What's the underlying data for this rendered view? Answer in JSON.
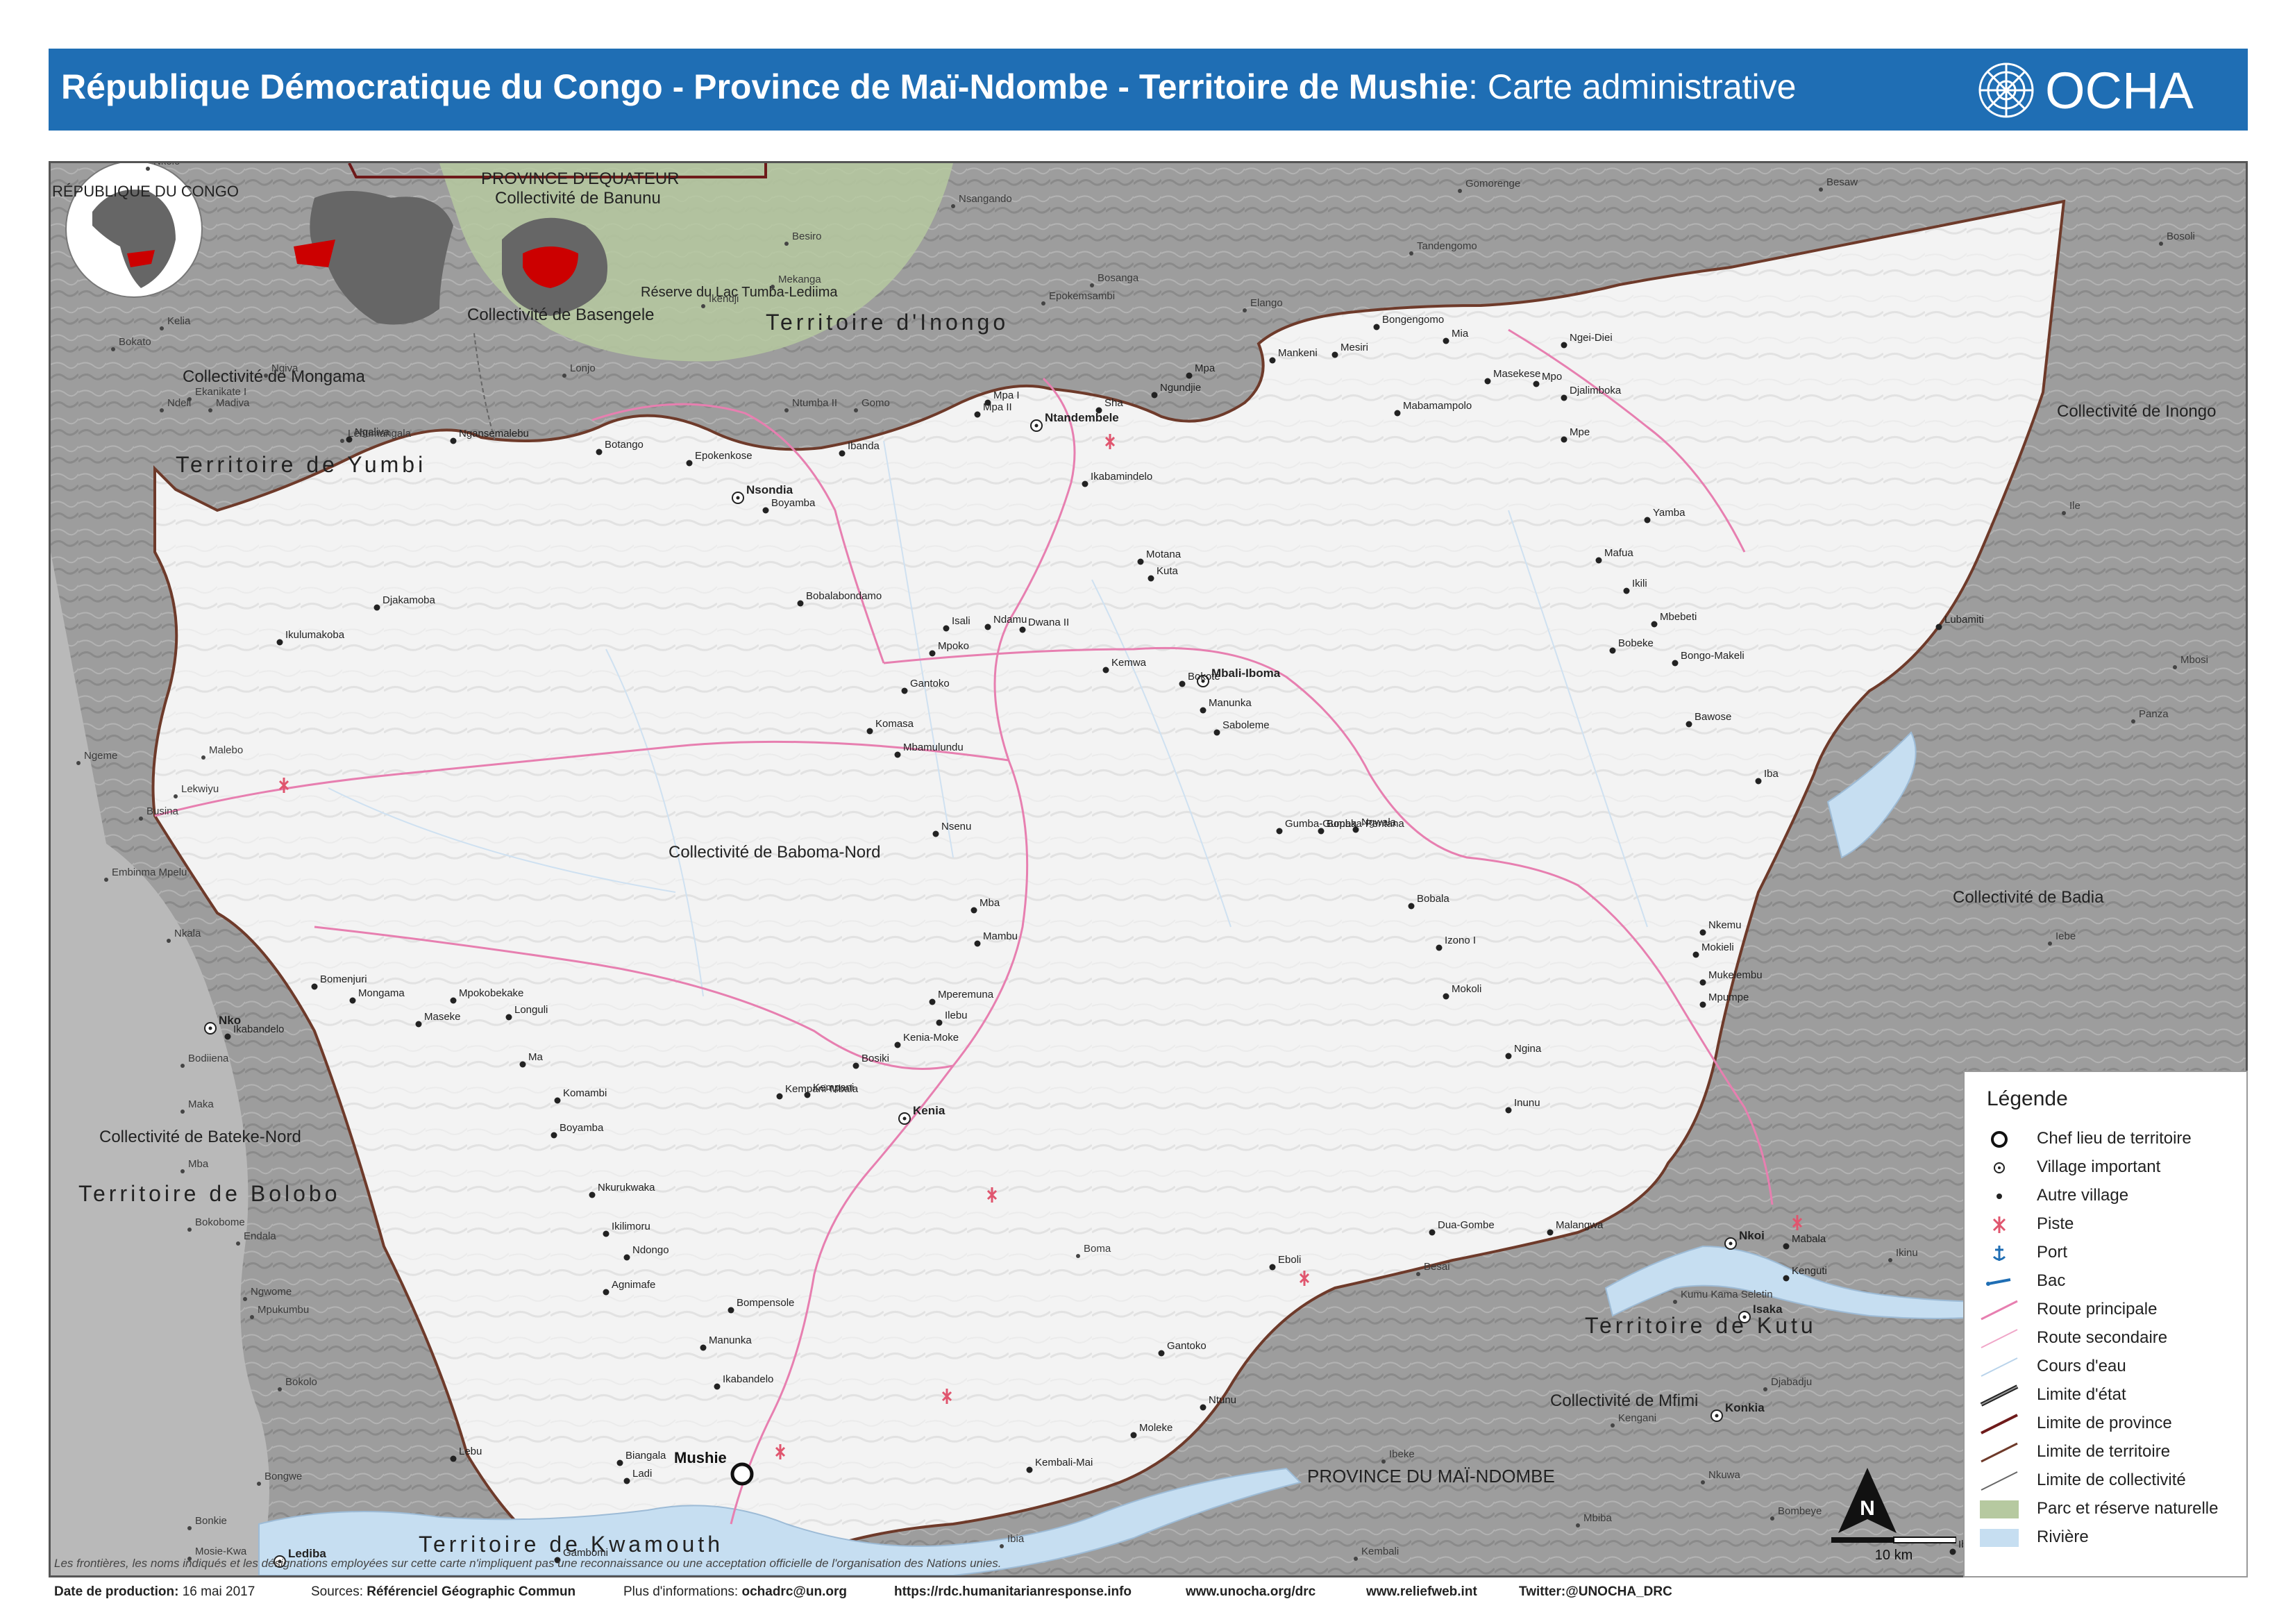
{
  "header": {
    "title_bold": "République Démocratique du Congo - Province de Maï-Ndombe - Territoire de Mushie",
    "title_rest": ": Carte administrative",
    "logo_text": "OCHA",
    "color": "#1f6eb4"
  },
  "map": {
    "region_labels": {
      "territoire_inongo": "Territoire d'Inongo",
      "territoire_yumbi": "Territoire de Yumbi",
      "territoire_bolobo": "Territoire de Bolobo",
      "territoire_kwamouth": "Territoire de Kwamouth",
      "territoire_kutu": "Territoire de Kutu",
      "province_equateur": "PROVINCE D'EQUATEUR",
      "province_maindombe": "PROVINCE DU MAÏ-NDOMBE",
      "coll_banunu": "Collectivité de Banunu",
      "coll_basengele": "Collectivité de Basengele",
      "coll_mongama": "Collectivité de Mongama",
      "coll_baboma_nord": "Collectivité de Baboma-Nord",
      "coll_bateke_nord": "Collectivité de Bateke-Nord",
      "coll_inongo": "Collectivité de Inongo",
      "coll_badia": "Collectivité de Badia",
      "coll_mfimi": "Collectivité de Mfimi",
      "reserve": "Réserve du Lac Tumba-Lediima",
      "rep_congo": "RÉPUBLIQUE DU CONGO"
    },
    "chef_lieu": "Mushie",
    "important_villages": [
      "Ntandembele",
      "Mbali-Iboma",
      "Kenia",
      "Nsondia",
      "Nko",
      "Nkoi",
      "Isaka",
      "Lediba",
      "Konkia"
    ],
    "villages": [
      "Ntandembele",
      "Mpa I",
      "Mpa II",
      "Ikabamindelo",
      "Boyamba",
      "Botango",
      "Epokenkose",
      "Ibanda",
      "Ngansemalebu",
      "Ngaliva",
      "Djakamoba",
      "Ikulumakoba",
      "Bobalabondamo",
      "Isali",
      "Ndamu",
      "Dwana II",
      "Motana",
      "Kuta",
      "Mpoko",
      "Gantoko",
      "Komasa",
      "Mbamulundu",
      "Kemwa",
      "Bokote",
      "Manunka",
      "Saboleme",
      "Gumba-Gumba",
      "Bopaka-Pentana",
      "Nsenu",
      "Mba",
      "Mambu",
      "Mperemuna",
      "Ilebu",
      "Kenia-Moke",
      "Bosiki",
      "Kempani-Mbala",
      "Kempani",
      "Bomenjuri",
      "Mongama",
      "Mpokobekake",
      "Longuli",
      "Maseke",
      "Ikabandelo",
      "Ma",
      "Komambi",
      "Boyamba",
      "Nkurukwaka",
      "Ikilimoru",
      "Ndongo",
      "Agnimafe",
      "Bompensole",
      "Manunka",
      "Ikabandelo",
      "Biangala",
      "Ladi",
      "Lebu",
      "Bobala",
      "Izono I",
      "Mokoli",
      "Mokieli",
      "Nkemu",
      "Mukelembu",
      "Mpumpe",
      "Ngina",
      "Inunu",
      "Kenguti",
      "Mabala",
      "Dua-Gombe",
      "Malangwa",
      "Eboli",
      "Gantoko",
      "Ntunu",
      "Moleke",
      "Kembali-Mai",
      "Ibaka",
      "Gambomi",
      "Mankeni",
      "Mpa",
      "Ngundjie",
      "Sha",
      "Mesiri",
      "Bongengomo",
      "Mia",
      "Ngei-Diei",
      "Djalimboka",
      "Masekese",
      "Mpo",
      "Mabamampolo",
      "Mpe",
      "Yamba",
      "Mafua",
      "Ikili",
      "Mbebeti",
      "Bobeke",
      "Bongo-Makeli",
      "Bawose",
      "Iba",
      "Lubamiti",
      "Ngwala"
    ],
    "outside_villages": [
      "Nkolo",
      "Nsangando",
      "Besiro",
      "Mekanga",
      "Bosanga",
      "Epokemsambi",
      "Elango",
      "Gomorenge",
      "Besaw",
      "Tandengomo",
      "Bosoli",
      "Ikendji",
      "Lonjo",
      "Ntumba II",
      "Gomo",
      "Ekanikate I",
      "Ndeli",
      "Madiva",
      "Lebumangala",
      "Ngiva",
      "Kelia",
      "Bokato",
      "Ngeme",
      "Malebo",
      "Lekwiyu",
      "Busina",
      "Embinma Mpelu",
      "Nkala",
      "Bodiiena",
      "Maka",
      "Mba",
      "Bokobome",
      "Endala",
      "Ngwome",
      "Mpukumbu",
      "Bokolo",
      "Bongwe",
      "Bonkie",
      "Mosie-Kwa",
      "Iebe",
      "Panza",
      "Ile",
      "Mbosi",
      "Ikinu",
      "Boma",
      "Besai",
      "Kumu Kama Seletin",
      "Djabadju",
      "Kengani",
      "Nkuwa",
      "Bombeye",
      "Mbiba",
      "Ibia",
      "Kembali",
      "Ibeke"
    ],
    "water_color": "#c6def1",
    "park_color": "#b6c9a0",
    "road_color": "#e77fb0",
    "territory_fill": "#f4f4f4"
  },
  "legend": {
    "title": "Légende",
    "items": [
      {
        "label": "Chef lieu de territoire",
        "symbol": "chef-lieu"
      },
      {
        "label": "Village important",
        "symbol": "village-important"
      },
      {
        "label": "Autre village",
        "symbol": "autre-village"
      },
      {
        "label": "Piste",
        "symbol": "piste"
      },
      {
        "label": "Port",
        "symbol": "port"
      },
      {
        "label": "Bac",
        "symbol": "bac"
      },
      {
        "label": "Route principale",
        "symbol": "route-principale"
      },
      {
        "label": "Route secondaire",
        "symbol": "route-secondaire"
      },
      {
        "label": "Cours d'eau",
        "symbol": "cours-eau"
      },
      {
        "label": "Limite d'état",
        "symbol": "limite-etat"
      },
      {
        "label": "Limite de province",
        "symbol": "limite-province"
      },
      {
        "label": "Limite de territoire",
        "symbol": "limite-territoire"
      },
      {
        "label": "Limite de collectivité",
        "symbol": "limite-collectivite"
      },
      {
        "label": "Parc et réserve naturelle",
        "symbol": "parc"
      },
      {
        "label": "Rivière",
        "symbol": "riviere"
      }
    ]
  },
  "north_label": "N",
  "scale_label": "10 km",
  "disclaimer": "Les frontières, les noms indiqués et les désignations employées sur cette carte n'impliquent pas une reconnaissance ou une acceptation officielle de l'organisation des Nations unies.",
  "footer": {
    "date_label": "Date de production:",
    "date_value": "16 mai 2017",
    "sources_label": "Sources:",
    "sources_value": "Référenciel  Géographic  Commun",
    "info_label": "Plus d'informations:",
    "info_value": "ochadrc@un.org",
    "url1": "https://rdc.humanitarianresponse.info",
    "url2": "www.unocha.org/drc",
    "url3": "www.reliefweb.int",
    "twitter": "Twitter:@UNOCHA_DRC"
  }
}
